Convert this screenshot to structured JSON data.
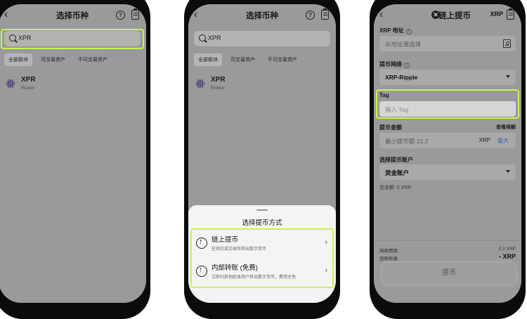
{
  "phone1": {
    "title": "选择币种",
    "search_value": "XPR",
    "tabs": [
      "全部板块",
      "可交易资产",
      "不可交易资产"
    ],
    "coin": {
      "name": "XPR",
      "subtitle": "Proton"
    }
  },
  "phone2": {
    "title": "选择币种",
    "search_value": "XPR",
    "tabs": [
      "全部板块",
      "可交易资产",
      "不可交易资产"
    ],
    "coin": {
      "name": "XPR",
      "subtitle": "Proton"
    },
    "sheet_title": "选择提币方式",
    "options": [
      {
        "label": "链上提币",
        "desc": "往钱包或交易所转出数字货币"
      },
      {
        "label": "内部转账 (免费)",
        "desc": "立即向其他欧易用户转出数字货币，费用全免"
      }
    ]
  },
  "phone3": {
    "title": "链上提币",
    "currency": "XRP",
    "address_label": "XRP 地址",
    "address_placeholder": "从地址簿选择",
    "network_label": "提币网络",
    "network_value": "XRP-Ripple",
    "tag_label": "Tag",
    "tag_placeholder": "输入 Tag",
    "amount_label": "提币金额",
    "amount_link": "查看限额",
    "amount_placeholder": "最小提币额 21.2",
    "amount_unit": "XRP",
    "amount_max": "最大",
    "account_label": "选择提币账户",
    "account_value": "资金账户",
    "balance_text": "总余额: 0 XRP",
    "fee_label": "网络费用",
    "fee_value": "0.2 XRP",
    "receive_label": "到账数量",
    "receive_value": "- XRP",
    "submit_label": "提币"
  },
  "colors": {
    "highlight": "#c8f54a",
    "link": "#3b5db8"
  }
}
